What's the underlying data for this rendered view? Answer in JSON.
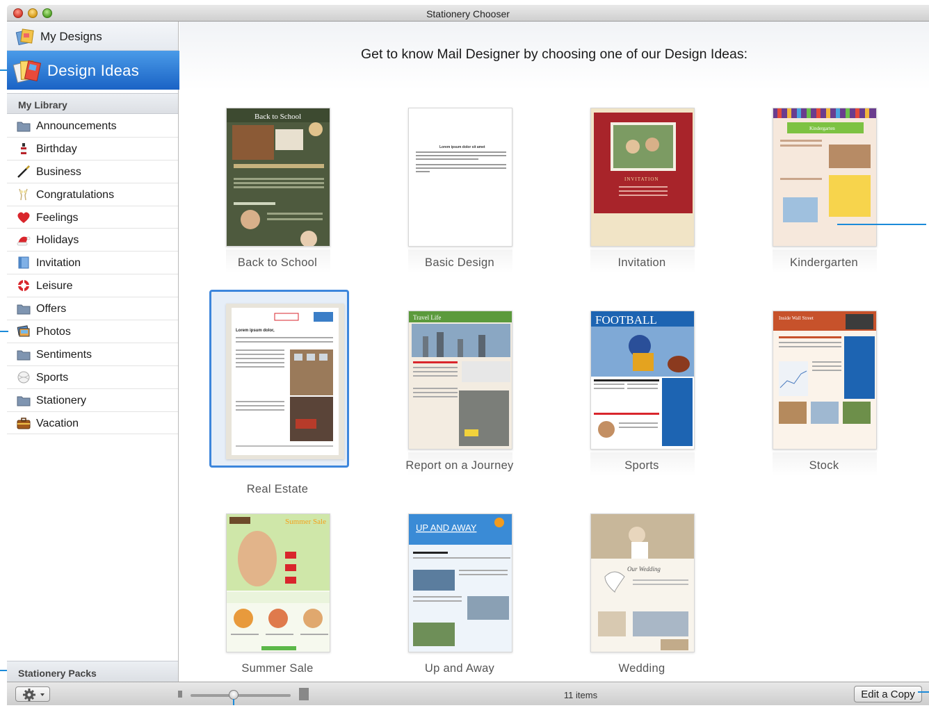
{
  "window": {
    "title": "Stationery Chooser"
  },
  "sidebar": {
    "my_designs": "My Designs",
    "design_ideas": "Design Ideas",
    "library_header": "My Library",
    "categories": [
      {
        "label": "Announcements",
        "icon": "folder-icon"
      },
      {
        "label": "Birthday",
        "icon": "bottle-icon"
      },
      {
        "label": "Business",
        "icon": "pen-icon"
      },
      {
        "label": "Congratulations",
        "icon": "champagne-icon"
      },
      {
        "label": "Feelings",
        "icon": "heart-icon"
      },
      {
        "label": "Holidays",
        "icon": "santa-hat-icon"
      },
      {
        "label": "Invitation",
        "icon": "invitation-card-icon"
      },
      {
        "label": "Leisure",
        "icon": "lifebuoy-icon"
      },
      {
        "label": "Offers",
        "icon": "folder-icon"
      },
      {
        "label": "Photos",
        "icon": "photos-icon"
      },
      {
        "label": "Sentiments",
        "icon": "folder-icon"
      },
      {
        "label": "Sports",
        "icon": "ball-icon"
      },
      {
        "label": "Stationery",
        "icon": "folder-icon"
      },
      {
        "label": "Vacation",
        "icon": "suitcase-icon"
      }
    ],
    "packs_header": "Stationery Packs"
  },
  "main": {
    "headline": "Get to know Mail Designer by choosing one of our Design Ideas:",
    "designs": [
      {
        "name": "Back to School",
        "header_text": "Back to School"
      },
      {
        "name": "Basic Design",
        "header_text": "Lorem ipsum dolor sit amet"
      },
      {
        "name": "Invitation",
        "header_text": "INVITATION"
      },
      {
        "name": "Kindergarten",
        "header_text": "Kindergarten"
      },
      {
        "name": "Real Estate",
        "header_text": "Lorem ipsum dolor,"
      },
      {
        "name": "Report on a Journey",
        "header_text": "Travel Life"
      },
      {
        "name": "Sports",
        "header_text": "FOOTBALL"
      },
      {
        "name": "Stock",
        "header_text": "Inside Wall Street"
      },
      {
        "name": "Summer Sale",
        "header_text": "Summer Sale"
      },
      {
        "name": "Up and Away",
        "header_text": "UP AND AWAY"
      },
      {
        "name": "Wedding",
        "header_text": "Our Wedding"
      }
    ],
    "selected": "Real Estate"
  },
  "bottombar": {
    "items_count": "11 items",
    "edit_copy": "Edit a Copy",
    "zoom_level": 0.43
  },
  "colors": {
    "accent": "#1a63c5",
    "selection": "#3d86dc",
    "callout": "#1b8ad9"
  }
}
